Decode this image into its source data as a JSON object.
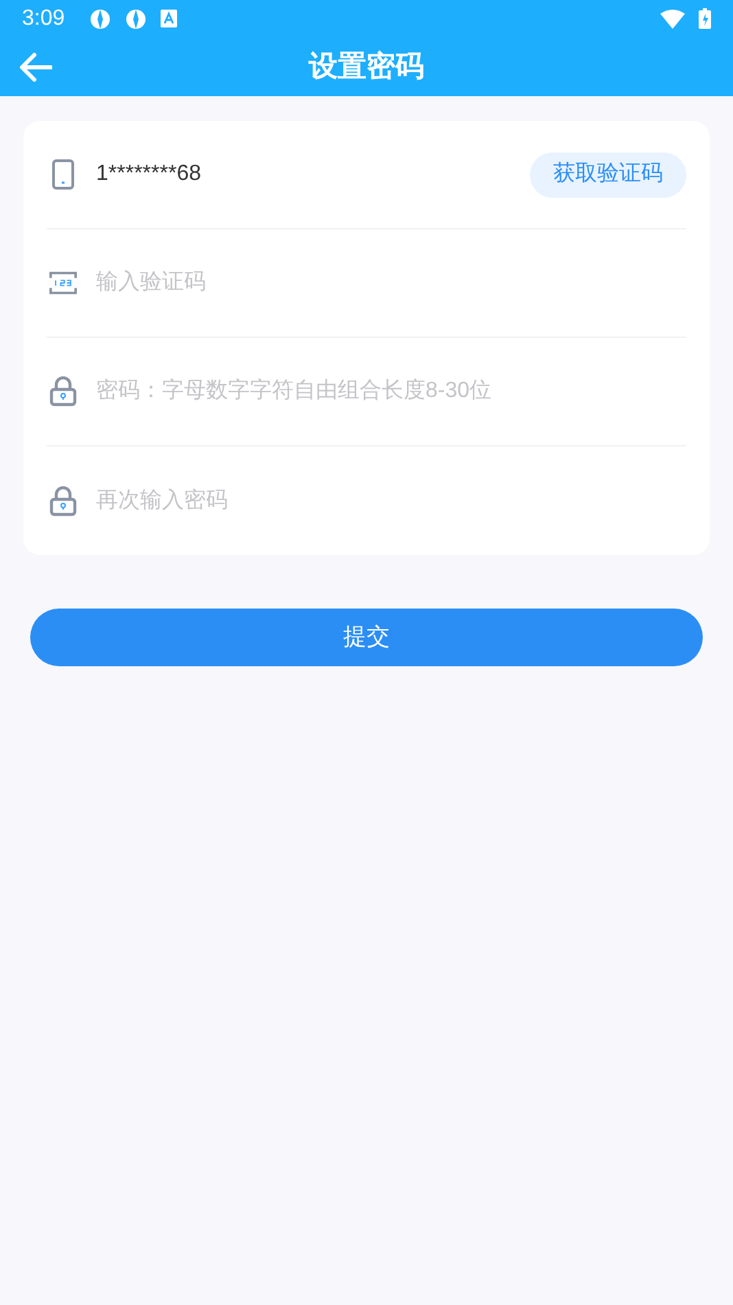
{
  "status_bar": {
    "time": "3:09"
  },
  "app_bar": {
    "title": "设置密码"
  },
  "fields": [
    {
      "kind": "phone",
      "value": "1********68",
      "button": "获取验证码"
    },
    {
      "kind": "code",
      "placeholder": "输入验证码"
    },
    {
      "kind": "lock",
      "placeholder": "密码：字母数字字符自由组合长度8-30位"
    },
    {
      "kind": "lock",
      "placeholder": "再次输入密码"
    }
  ],
  "submit": "提交"
}
